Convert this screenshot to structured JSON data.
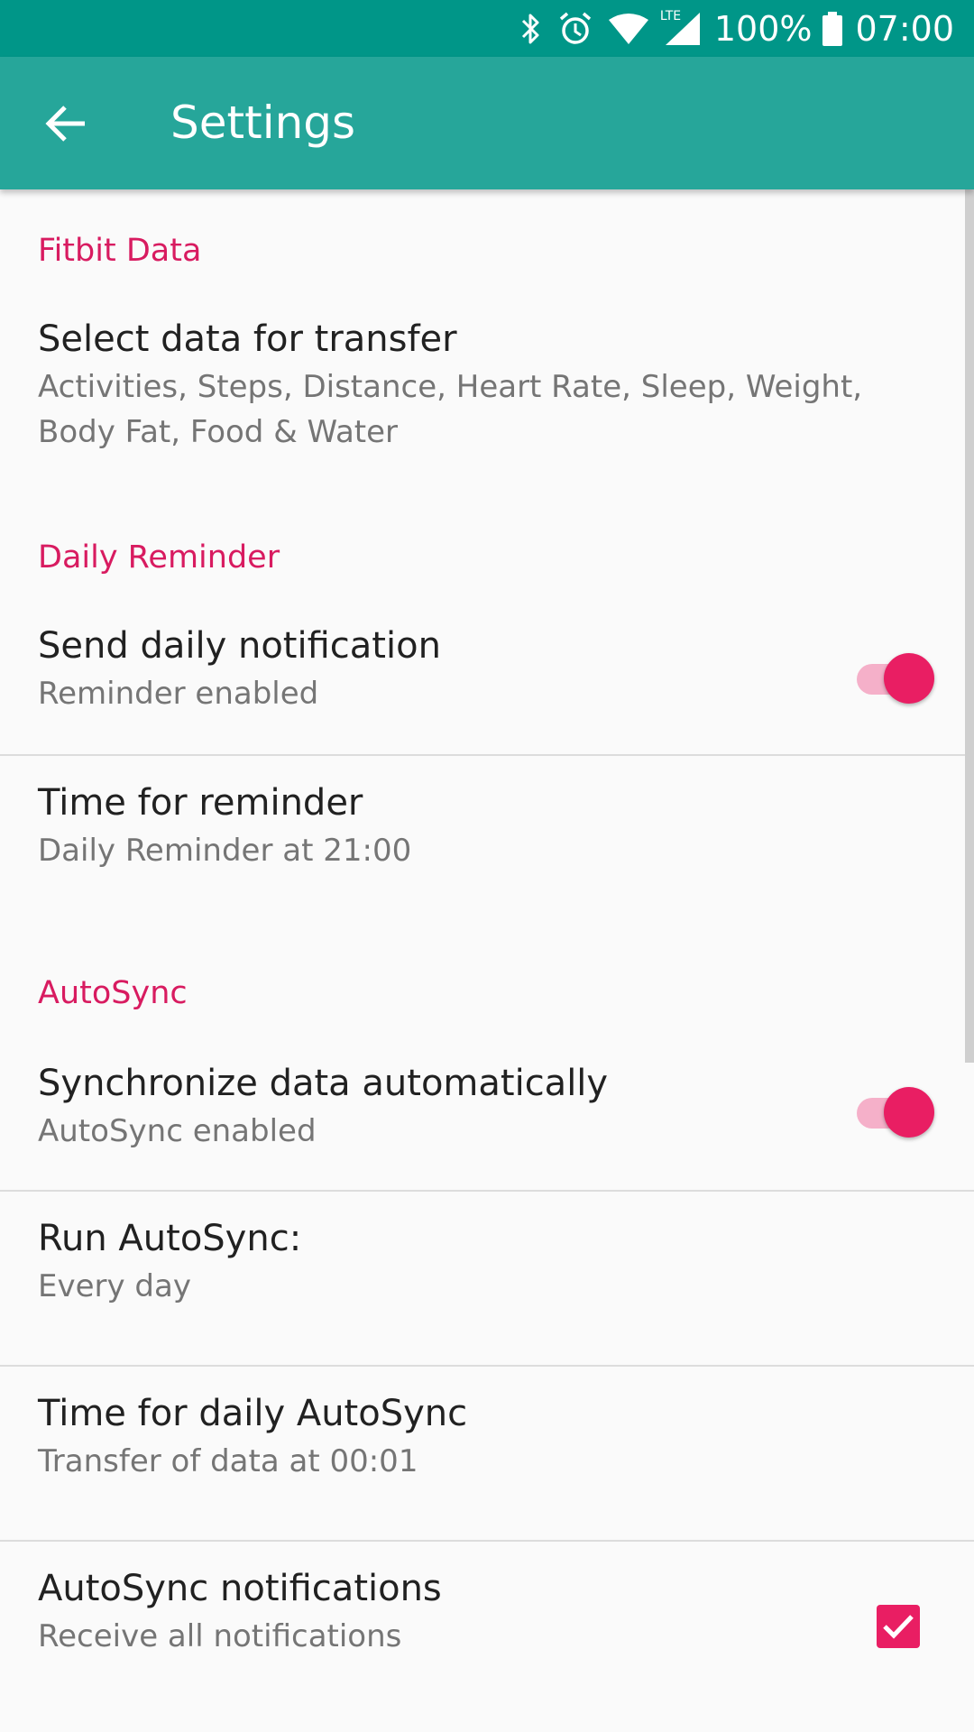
{
  "status_bar": {
    "battery": "100%",
    "time": "07:00",
    "network": "LTE",
    "icons": [
      "bluetooth-icon",
      "alarm-icon",
      "wifi-icon",
      "lte-icon",
      "signal-icon",
      "battery-icon"
    ]
  },
  "app_bar": {
    "title": "Settings",
    "back_icon": "arrow-left-icon"
  },
  "colors": {
    "status_bar": "#009688",
    "app_bar": "#26a69a",
    "accent": "#e91e63",
    "category_text": "#d81b60"
  },
  "sections": {
    "fitbit_data": {
      "header": "Fitbit Data",
      "select_data": {
        "title": "Select data for transfer",
        "summary": "Activities, Steps, Distance, Heart Rate, Sleep, Weight, Body Fat, Food & Water"
      }
    },
    "daily_reminder": {
      "header": "Daily Reminder",
      "send_notification": {
        "title": "Send daily notification",
        "summary": "Reminder enabled",
        "enabled": true
      },
      "time_for_reminder": {
        "title": "Time for reminder",
        "summary": "Daily Reminder at 21:00"
      }
    },
    "autosync": {
      "header": "AutoSync",
      "sync_automatically": {
        "title": "Synchronize data automatically",
        "summary": "AutoSync enabled",
        "enabled": true
      },
      "run_autosync": {
        "title": "Run AutoSync:",
        "summary": "Every day"
      },
      "time_for_daily": {
        "title": "Time for daily AutoSync",
        "summary": "Transfer of data at 00:01"
      },
      "notifications": {
        "title": "AutoSync notifications",
        "summary": "Receive all notifications",
        "checked": true
      }
    }
  }
}
